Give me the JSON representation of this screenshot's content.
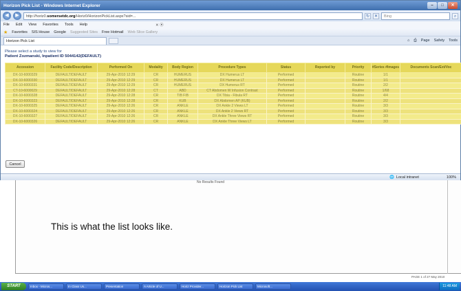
{
  "window": {
    "title": "Horizon Pick List - Windows Internet Explorer",
    "url_prefix": "http://horiz0.",
    "url_domain": "somersetdc.org",
    "url_rest": "/Horiz0/HorizonPickList.aspx?sid=...",
    "search_placeholder": "Bing"
  },
  "menu": [
    "File",
    "Edit",
    "View",
    "Favorites",
    "Tools",
    "Help"
  ],
  "favorites": {
    "label": "Favorites",
    "items": [
      "SIS House",
      "Google",
      "Suggested Sites",
      "Free Hotmail",
      "Web Slice Gallery"
    ]
  },
  "tab": {
    "label": "Horizon Pick List"
  },
  "toolbar_right": [
    "Page",
    "Safety",
    "Tools"
  ],
  "page": {
    "prompt_line1": "Please select a study to view for",
    "prompt_line2": "Patient Zozmanski, Inpatient ID 5044142(DEFAULT)"
  },
  "table": {
    "columns": [
      "Accession",
      "Facility Code/Description",
      "Performed On",
      "Modality",
      "Body Region",
      "Procedure Types",
      "Status",
      "Reported by",
      "Priority",
      "#Series #Images",
      "Documents Scan/Ext/Voc"
    ],
    "rows": [
      [
        "DX-10-6000329",
        "DEFAULT/DEFAULT",
        "29-Apr-2010 12:29",
        "CR",
        "HUMERUS",
        "DX Humerus LT",
        "Performed",
        "",
        "Routine",
        "1/1",
        ""
      ],
      [
        "DX-10-6000330",
        "DEFAULT/DEFAULT",
        "29-Apr-2010 12:29",
        "CR",
        "HUMERUS",
        "DX Humerus LT",
        "Performed",
        "",
        "Routine",
        "1/1",
        ""
      ],
      [
        "DX-10-6000331",
        "DEFAULT/DEFAULT",
        "29-Apr-2010 12:29",
        "CR",
        "HUMERUS",
        "DX Humerus RT",
        "Performed",
        "",
        "Routine",
        "2/2",
        ""
      ],
      [
        "CT-10-6000029",
        "DEFAULT/DEFAULT",
        "29-Apr-2010 12:28",
        "CT",
        "ABD",
        "CT Abdomen W Infusion Contrast",
        "Performed",
        "",
        "Routine",
        "1/68",
        ""
      ],
      [
        "DX-10-6000328",
        "DEFAULT/DEFAULT",
        "29-Apr-2010 12:28",
        "CR",
        "TIB FIB",
        "DX Tibia - Fibula RT",
        "Performed",
        "",
        "Routine",
        "4/4",
        ""
      ],
      [
        "DX-10-6000323",
        "DEFAULT/DEFAULT",
        "29-Apr-2010 12:28",
        "CR",
        "KUB",
        "DX Abdomen AP (KUB)",
        "Performed",
        "",
        "Routine",
        "2/2",
        ""
      ],
      [
        "DX-10-6000325",
        "DEFAULT/DEFAULT",
        "29-Apr-2010 12:26",
        "CR",
        "ANKLE",
        "DX Ankle 2 Views LT",
        "Performed",
        "",
        "Routine",
        "3/3",
        ""
      ],
      [
        "DX-10-6000324",
        "DEFAULT/DEFAULT",
        "29-Apr-2010 12:26",
        "CR",
        "ANKLE",
        "DX Ankle 2 Views RT",
        "Performed",
        "",
        "Routine",
        "3/3",
        ""
      ],
      [
        "DX-10-6000327",
        "DEFAULT/DEFAULT",
        "29-Apr-2010 12:26",
        "CR",
        "ANKLE",
        "DX Ankle Three Views RT",
        "Performed",
        "",
        "Routine",
        "3/3",
        ""
      ],
      [
        "DX-10-6000326",
        "DEFAULT/DEFAULT",
        "29-Apr-2010 12:26",
        "CR",
        "ANKLE",
        "DX Ankle Three Views LT",
        "Performed",
        "",
        "Routine",
        "3/3",
        ""
      ]
    ]
  },
  "cancel_label": "Cancel",
  "status": {
    "zone": "Local intranet",
    "zoom": "100%"
  },
  "below": {
    "no_results": "No Results Found",
    "caption": "This is what the list looks like."
  },
  "taskbar": {
    "start": "START",
    "items": [
      "Inbox - Micros...",
      "In Class Us...",
      "Presentation",
      "A Article of U...",
      "Horiz Provider...",
      "Horizon Pick List",
      "Microsoft..."
    ],
    "tray_time": "11:48 AM",
    "clock_text": "PAGE 1 of 27 May 2010"
  }
}
